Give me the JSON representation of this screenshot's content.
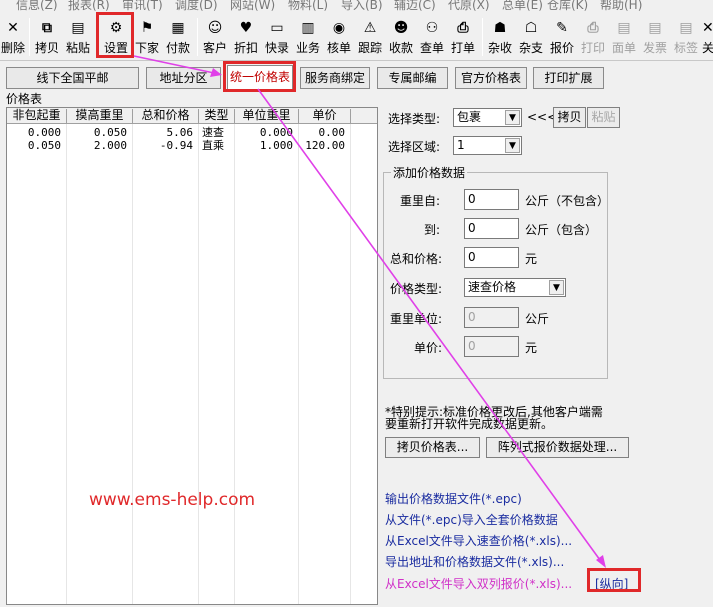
{
  "menu": [
    "信息(Z)",
    "报表(R)",
    "审讯(T)",
    "调度(D)",
    "网站(W)",
    "物料(L)",
    "导入(B)",
    "辅迈(C)",
    "代原(X)",
    "总单(E)",
    "仓库(K)",
    "帮助(H)"
  ],
  "toolbar": [
    {
      "label": "删除",
      "icon": "✕",
      "icon_name": "delete-icon",
      "disabled": true
    },
    {
      "label": "拷贝",
      "icon": "⧉",
      "icon_name": "copy-icon",
      "disabled": false
    },
    {
      "label": "粘贴",
      "icon": "▤",
      "icon_name": "paste-icon",
      "disabled": true
    },
    {
      "label": "设置",
      "icon": "⚙",
      "icon_name": "settings-icon",
      "disabled": false
    },
    {
      "label": "下家",
      "icon": "⚑",
      "icon_name": "downstream-icon",
      "disabled": false
    },
    {
      "label": "付款",
      "icon": "▦",
      "icon_name": "payment-icon",
      "disabled": false
    },
    {
      "label": "客户",
      "icon": "☺",
      "icon_name": "customer-icon",
      "disabled": false
    },
    {
      "label": "折扣",
      "icon": "♥",
      "icon_name": "discount-icon",
      "disabled": false
    },
    {
      "label": "快录",
      "icon": "▭",
      "icon_name": "quick-entry-icon",
      "disabled": false
    },
    {
      "label": "业务",
      "icon": "▥",
      "icon_name": "business-icon",
      "disabled": false
    },
    {
      "label": "核单",
      "icon": "◉",
      "icon_name": "check-order-icon",
      "disabled": false
    },
    {
      "label": "跟踪",
      "icon": "⚠",
      "icon_name": "track-icon",
      "disabled": false
    },
    {
      "label": "收款",
      "icon": "☻",
      "icon_name": "receive-payment-icon",
      "disabled": false
    },
    {
      "label": "查单",
      "icon": "⚇",
      "icon_name": "query-order-icon",
      "disabled": false
    },
    {
      "label": "打单",
      "icon": "⎙",
      "icon_name": "print-order-icon",
      "disabled": false
    },
    {
      "label": "杂收",
      "icon": "☗",
      "icon_name": "misc-receive-icon",
      "disabled": false
    },
    {
      "label": "杂支",
      "icon": "☖",
      "icon_name": "misc-pay-icon",
      "disabled": false
    },
    {
      "label": "报价",
      "icon": "✎",
      "icon_name": "quote-icon",
      "disabled": false
    },
    {
      "label": "打印",
      "icon": "⎙",
      "icon_name": "print-icon",
      "disabled": true
    },
    {
      "label": "面单",
      "icon": "▤",
      "icon_name": "waybill-icon",
      "disabled": true
    },
    {
      "label": "发票",
      "icon": "▤",
      "icon_name": "invoice-icon",
      "disabled": true
    },
    {
      "label": "标签",
      "icon": "▤",
      "icon_name": "label-icon",
      "disabled": true
    },
    {
      "label": "关",
      "icon": "✕",
      "icon_name": "close-icon",
      "disabled": false
    }
  ],
  "tabs": [
    {
      "label": "线下全国平邮",
      "active": false
    },
    {
      "label": "地址分区",
      "active": false
    },
    {
      "label": "统一价格表",
      "active": true
    },
    {
      "label": "服务商绑定",
      "active": false
    },
    {
      "label": "专属邮编",
      "active": false
    },
    {
      "label": "官方价格表",
      "active": false
    },
    {
      "label": "打印扩展",
      "active": false
    }
  ],
  "price_table": {
    "label": "价格表",
    "columns": [
      "非包起重",
      "摸高重里",
      "总和价格",
      "类型",
      "单位重里",
      "单价"
    ],
    "rows": [
      [
        "0.000",
        "0.050",
        "5.06",
        "速查",
        "0.000",
        "0.00"
      ],
      [
        "0.050",
        "2.000",
        "-0.94",
        "直乘",
        "1.000",
        "120.00"
      ]
    ]
  },
  "form": {
    "select_type_label": "选择类型:",
    "select_type_value": "包裹",
    "nav_arrows": "<<<",
    "copy_button": "拷贝",
    "paste_button": "粘贴",
    "select_zone_label": "选择区域:",
    "select_zone_value": "1",
    "group_title": "添加价格数据",
    "weight_from_label": "重里自:",
    "weight_from_value": "0",
    "weight_from_unit": "公斤（不包含）",
    "weight_to_label": "到:",
    "weight_to_value": "0",
    "weight_to_unit": "公斤（包含）",
    "total_price_label": "总和价格:",
    "total_price_value": "0",
    "total_price_unit": "元",
    "price_type_label": "价格类型:",
    "price_type_value": "速查价格",
    "weight_unit_label": "重里单位:",
    "weight_unit_value": "0",
    "weight_unit_unit": "公斤",
    "unit_price_label": "单价:",
    "unit_price_value": "0",
    "unit_price_unit": "元"
  },
  "tip_line1": "*特别提示:标准价格更改后,其他客户端需",
  "tip_line2": "要重新打开软件完成数据更新。",
  "copy_price_table_button": "拷贝价格表...",
  "matrix_button": "阵列式报价数据处理...",
  "links": {
    "export_epc": "输出价格数据文件(*.epc)",
    "import_epc": "从文件(*.epc)导入全套价格数据",
    "import_excel_quick": "从Excel文件导入速查价格(*.xls)...",
    "export_address": "导出地址和价格数据文件(*.xls)...",
    "import_excel_dual": "从Excel文件导入双列报价(*.xls)...",
    "vertical": "[纵向]"
  },
  "watermark": "www.ems-help.com",
  "colors": {
    "highlight": "#e0282a",
    "arrow": "#e040e8",
    "link": "#1a2ca0",
    "link_magenta": "#d030c8"
  }
}
